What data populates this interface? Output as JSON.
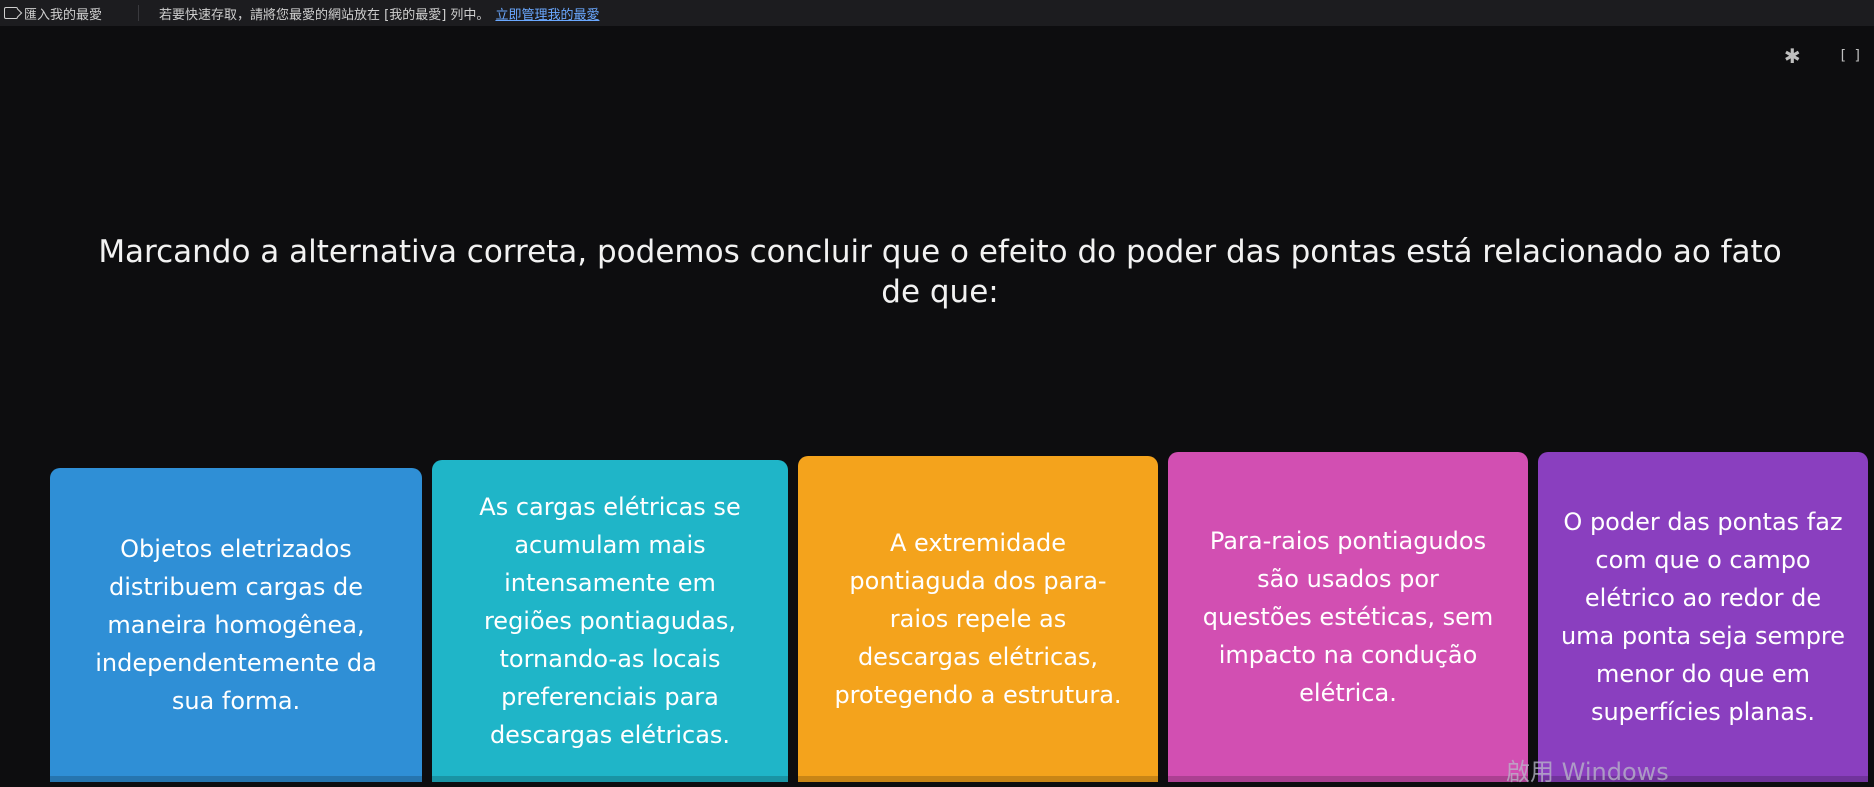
{
  "bookmarks_bar": {
    "import_label": "匯入我的最愛",
    "hint_text": "若要快速存取，請將您最愛的網站放在 [我的最愛] 列中。",
    "manage_link": "立即管理我的最愛"
  },
  "controls": {
    "settings_icon": "gear-icon",
    "fullscreen_icon": "fullscreen-icon",
    "settings_glyph": "✱",
    "fullscreen_glyph": "[ ]"
  },
  "question": {
    "line1": "Marcando a alternativa correta, podemos concluir que o efeito do poder das pontas está relacionado ao fato",
    "line2": "de que:"
  },
  "answers": [
    {
      "color": "#2f8fd6",
      "lines": [
        "Objetos eletrizados",
        "distribuem cargas de",
        "maneira homogênea,",
        "independentemente da",
        "sua forma."
      ]
    },
    {
      "color": "#1fb5c8",
      "lines": [
        "As cargas elétricas se",
        "acumulam mais",
        "intensamente em",
        "regiões pontiagudas,",
        "tornando-as locais",
        "preferenciais para",
        "descargas elétricas."
      ]
    },
    {
      "color": "#f4a31c",
      "lines": [
        "A extremidade",
        "pontiaguda dos para-",
        "raios repele as",
        "descargas elétricas,",
        "protegendo a estrutura."
      ]
    },
    {
      "color": "#d24fb2",
      "lines": [
        "Para-raios pontiagudos",
        "são usados por",
        "questões estéticas, sem",
        "impacto na condução",
        "elétrica."
      ]
    },
    {
      "color": "#8a3fbf",
      "lines": [
        "O poder das pontas faz",
        "com que o campo",
        "elétrico ao redor de",
        "uma ponta seja sempre",
        "menor do que em",
        "superfícies planas."
      ]
    }
  ],
  "watermark": "啟用 Windows"
}
